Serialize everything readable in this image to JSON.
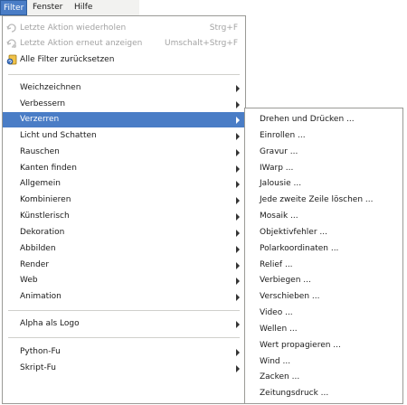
{
  "menubar": {
    "items": [
      {
        "label": "Filter"
      },
      {
        "label": "Fenster"
      },
      {
        "label": "Hilfe"
      }
    ]
  },
  "filter_menu": {
    "top_items": [
      {
        "label": "Letzte Aktion wiederholen",
        "accel": "Strg+F",
        "enabled": false,
        "icon": "repeat-icon"
      },
      {
        "label": "Letzte Aktion erneut anzeigen",
        "accel": "Umschalt+Strg+F",
        "enabled": false,
        "icon": "reshow-icon"
      },
      {
        "label": "Alle Filter zurücksetzen",
        "accel": "",
        "enabled": true,
        "icon": "reset-filters-icon"
      }
    ],
    "categories": [
      {
        "label": "Weichzeichnen"
      },
      {
        "label": "Verbessern"
      },
      {
        "label": "Verzerren",
        "selected": true
      },
      {
        "label": "Licht und Schatten"
      },
      {
        "label": "Rauschen"
      },
      {
        "label": "Kanten finden"
      },
      {
        "label": "Allgemein"
      },
      {
        "label": "Kombinieren"
      },
      {
        "label": "Künstlerisch"
      },
      {
        "label": "Dekoration"
      },
      {
        "label": "Abbilden"
      },
      {
        "label": "Render"
      },
      {
        "label": "Web"
      },
      {
        "label": "Animation"
      }
    ],
    "alpha_item": {
      "label": "Alpha als Logo"
    },
    "script_items": [
      {
        "label": "Python-Fu"
      },
      {
        "label": "Skript-Fu"
      }
    ]
  },
  "distort_submenu": {
    "items": [
      {
        "label": "Drehen und Drücken ..."
      },
      {
        "label": "Einrollen ..."
      },
      {
        "label": "Gravur ..."
      },
      {
        "label": "IWarp ..."
      },
      {
        "label": "Jalousie ..."
      },
      {
        "label": "Jede zweite Zeile löschen ..."
      },
      {
        "label": "Mosaik ..."
      },
      {
        "label": "Objektivfehler ..."
      },
      {
        "label": "Polarkoordinaten ..."
      },
      {
        "label": "Relief ..."
      },
      {
        "label": "Verbiegen ..."
      },
      {
        "label": "Verschieben ..."
      },
      {
        "label": "Video ..."
      },
      {
        "label": "Wellen ..."
      },
      {
        "label": "Wert propagieren ..."
      },
      {
        "label": "Wind ..."
      },
      {
        "label": "Zacken ..."
      },
      {
        "label": "Zeitungsdruck ..."
      }
    ]
  },
  "colors": {
    "selection": "#4a7dc6",
    "disabled_text": "#a3a3a3"
  }
}
